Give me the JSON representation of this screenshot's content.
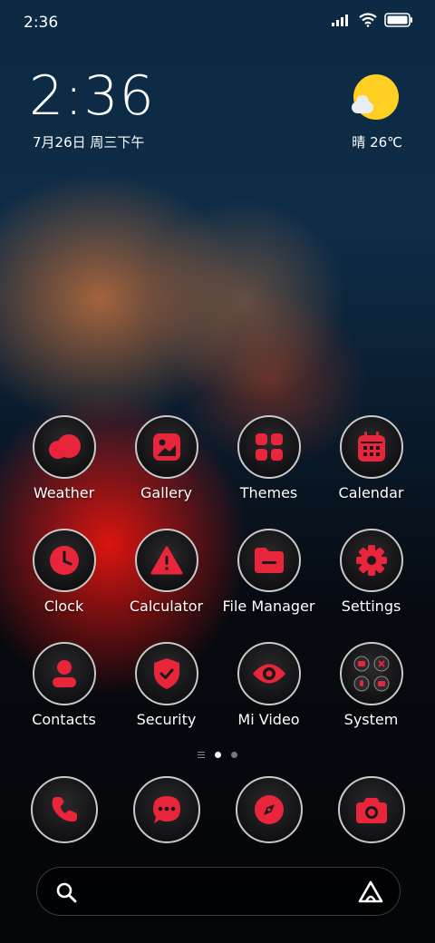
{
  "status_bar": {
    "time": "2:36"
  },
  "lockclock": {
    "time": "2:36",
    "date": "7月26日 周三下午"
  },
  "weather": {
    "condition_temp": "晴 26℃"
  },
  "apps": [
    {
      "label": "Weather",
      "icon": "weather-icon"
    },
    {
      "label": "Gallery",
      "icon": "gallery-icon"
    },
    {
      "label": "Themes",
      "icon": "themes-icon"
    },
    {
      "label": "Calendar",
      "icon": "calendar-icon"
    },
    {
      "label": "Clock",
      "icon": "clock-icon"
    },
    {
      "label": "Calculator",
      "icon": "calculator-icon"
    },
    {
      "label": "File Manager",
      "icon": "folder-icon"
    },
    {
      "label": "Settings",
      "icon": "gear-icon"
    },
    {
      "label": "Contacts",
      "icon": "person-icon"
    },
    {
      "label": "Security",
      "icon": "shield-icon"
    },
    {
      "label": "Mi Video",
      "icon": "eye-icon"
    },
    {
      "label": "System",
      "icon": "folder-grid-icon"
    }
  ],
  "dock": [
    {
      "icon": "phone-icon"
    },
    {
      "icon": "message-icon"
    },
    {
      "icon": "compass-icon"
    },
    {
      "icon": "camera-icon"
    }
  ],
  "colors": {
    "accent": "#e8253a",
    "ring": "#c9c9c9"
  }
}
